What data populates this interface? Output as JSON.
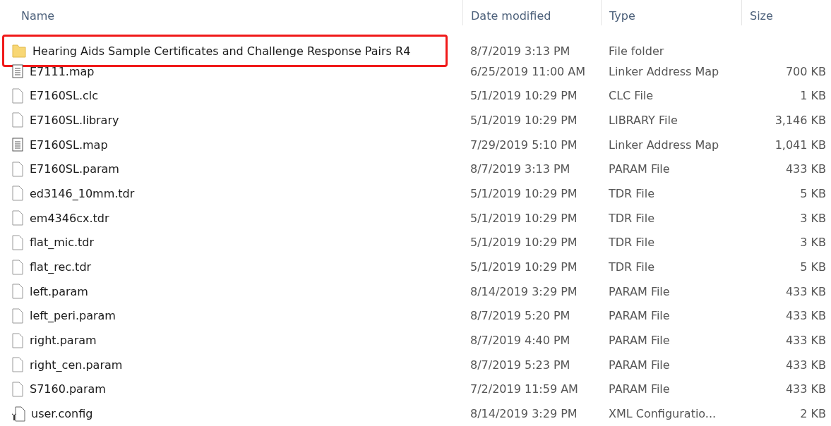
{
  "columns": [
    {
      "label": "Name"
    },
    {
      "label": "Date modified"
    },
    {
      "label": "Type"
    },
    {
      "label": "Size"
    }
  ],
  "rows": [
    {
      "kind": "folder",
      "name": "Hearing Aids Sample Certificates and Challenge Response Pairs R4",
      "date": "8/7/2019 3:13 PM",
      "type": "File folder",
      "highlighted": true
    },
    {
      "kind": "map",
      "name": "E7111.map",
      "date": "6/25/2019 11:00 AM",
      "type": "Linker Address Map",
      "size": "700 KB",
      "highlighted": false
    },
    {
      "kind": "file",
      "name": "E7160SL.clc",
      "date": "5/1/2019 10:29 PM",
      "type": "CLC File",
      "size": "1 KB",
      "highlighted": false
    },
    {
      "kind": "file",
      "name": "E7160SL.library",
      "date": "5/1/2019 10:29 PM",
      "type": "LIBRARY File",
      "size": "3,146 KB",
      "highlighted": false
    },
    {
      "kind": "map",
      "name": "E7160SL.map",
      "date": "7/29/2019 5:10 PM",
      "type": "Linker Address Map",
      "size": "1,041 KB",
      "highlighted": false
    },
    {
      "kind": "file",
      "name": "E7160SL.param",
      "date": "8/7/2019 3:13 PM",
      "type": "PARAM File",
      "size": "433 KB",
      "highlighted": false
    },
    {
      "kind": "file",
      "name": "ed3146_10mm.tdr",
      "date": "5/1/2019 10:29 PM",
      "type": "TDR File",
      "size": "5 KB",
      "highlighted": false
    },
    {
      "kind": "file",
      "name": "em4346cx.tdr",
      "date": "5/1/2019 10:29 PM",
      "type": "TDR File",
      "size": "3 KB",
      "highlighted": false
    },
    {
      "kind": "file",
      "name": "flat_mic.tdr",
      "date": "5/1/2019 10:29 PM",
      "type": "TDR File",
      "size": "3 KB",
      "highlighted": false
    },
    {
      "kind": "file",
      "name": "flat_rec.tdr",
      "date": "5/1/2019 10:29 PM",
      "type": "TDR File",
      "size": "5 KB",
      "highlighted": false
    },
    {
      "kind": "file",
      "name": "left.param",
      "date": "8/14/2019 3:29 PM",
      "type": "PARAM File",
      "size": "433 KB",
      "highlighted": false
    },
    {
      "kind": "file",
      "name": "left_peri.param",
      "date": "8/7/2019 5:20 PM",
      "type": "PARAM File",
      "size": "433 KB",
      "highlighted": false
    },
    {
      "kind": "file",
      "name": "right.param",
      "date": "8/7/2019 4:40 PM",
      "type": "PARAM File",
      "size": "433 KB",
      "highlighted": false
    },
    {
      "kind": "file",
      "name": "right_cen.param",
      "date": "8/7/2019 5:23 PM",
      "type": "PARAM File",
      "size": "433 KB",
      "highlighted": false
    },
    {
      "kind": "file",
      "name": "S7160.param",
      "date": "7/2/2019 11:59 AM",
      "type": "PARAM File",
      "size": "433 KB",
      "highlighted": false
    },
    {
      "kind": "config",
      "name": "user.config",
      "date": "8/14/2019 3:29 PM",
      "type": "XML Configuratio...",
      "size": "2 KB",
      "highlighted": false
    }
  ]
}
